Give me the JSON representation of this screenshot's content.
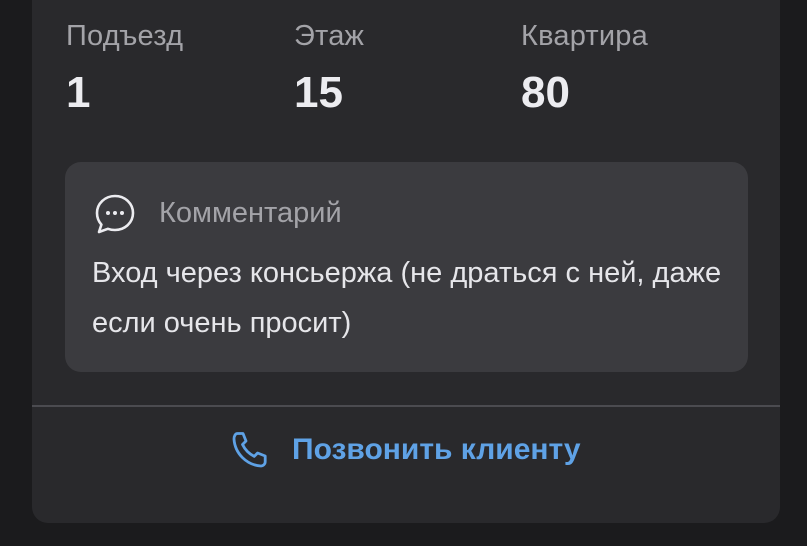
{
  "address_details": {
    "fields": [
      {
        "label": "Подъезд",
        "value": "1"
      },
      {
        "label": "Этаж",
        "value": "15"
      },
      {
        "label": "Квартира",
        "value": "80"
      }
    ]
  },
  "comment": {
    "icon": "chat-bubble-icon",
    "title": "Комментарий",
    "text": "Вход через консьержа (не драться с ней, даже если очень просит)"
  },
  "actions": {
    "call_icon": "phone-icon",
    "call_label": "Позвонить клиенту"
  },
  "colors": {
    "background": "#1b1b1d",
    "card": "#29292c",
    "comment_box": "#3b3b3f",
    "accent": "#5fa2e6",
    "muted_text": "#a3a3a8",
    "primary_text": "#ececf0"
  }
}
